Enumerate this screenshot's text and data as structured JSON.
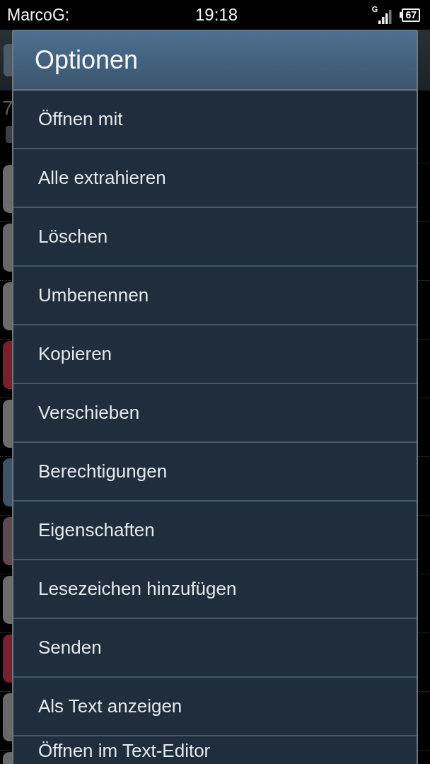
{
  "status_bar": {
    "carrier": "MarcoG:",
    "time": "19:18",
    "network": "G",
    "battery": "67"
  },
  "background": {
    "label": "7",
    "thumbnails": [
      {
        "color": "#6b6b6b"
      },
      {
        "color": "#676767"
      },
      {
        "color": "#6a6a6a"
      },
      {
        "color": "#7a1f2b"
      },
      {
        "color": "#6b6b6b"
      },
      {
        "color": "#3e5266"
      },
      {
        "color": "#5c4a50"
      },
      {
        "color": "#6b6b6b"
      },
      {
        "color": "#7a2030"
      },
      {
        "color": "#686868"
      },
      {
        "color": "#6a6a6a"
      }
    ]
  },
  "dialog": {
    "title": "Optionen",
    "items": [
      {
        "label": "Öffnen mit"
      },
      {
        "label": "Alle extrahieren"
      },
      {
        "label": "Löschen"
      },
      {
        "label": "Umbenennen"
      },
      {
        "label": "Kopieren"
      },
      {
        "label": "Verschieben"
      },
      {
        "label": "Berechtigungen"
      },
      {
        "label": "Eigenschaften"
      },
      {
        "label": "Lesezeichen hinzufügen"
      },
      {
        "label": "Senden"
      },
      {
        "label": "Als Text anzeigen"
      },
      {
        "label": "Öffnen im Text-Editor"
      }
    ]
  }
}
